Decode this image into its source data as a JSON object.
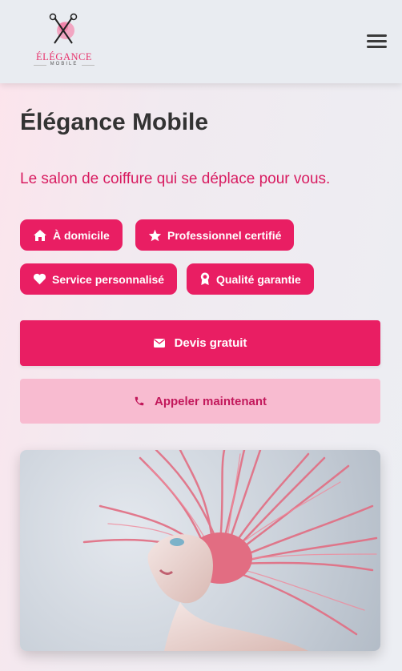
{
  "header": {
    "logo_text": "ÉLÉGANCE",
    "logo_subtext": "MOBILE",
    "menu_icon": "hamburger-menu-icon"
  },
  "hero": {
    "title": "Élégance Mobile",
    "tagline": "Le salon de coiffure qui se déplace pour vous."
  },
  "badges": [
    {
      "icon": "home-icon",
      "label": "À domicile"
    },
    {
      "icon": "star-icon",
      "label": "Professionnel certifié"
    },
    {
      "icon": "heart-icon",
      "label": "Service personnalisé"
    },
    {
      "icon": "award-icon",
      "label": "Qualité garantie"
    }
  ],
  "actions": {
    "primary": {
      "icon": "envelope-icon",
      "label": "Devis gratuit"
    },
    "secondary": {
      "icon": "phone-icon",
      "label": "Appeler maintenant"
    }
  },
  "image": {
    "subject": "woman-pink-hair-photo"
  },
  "colors": {
    "accent": "#e91e63",
    "accent_light": "#f8bbd0",
    "tagline": "#d81b60"
  }
}
